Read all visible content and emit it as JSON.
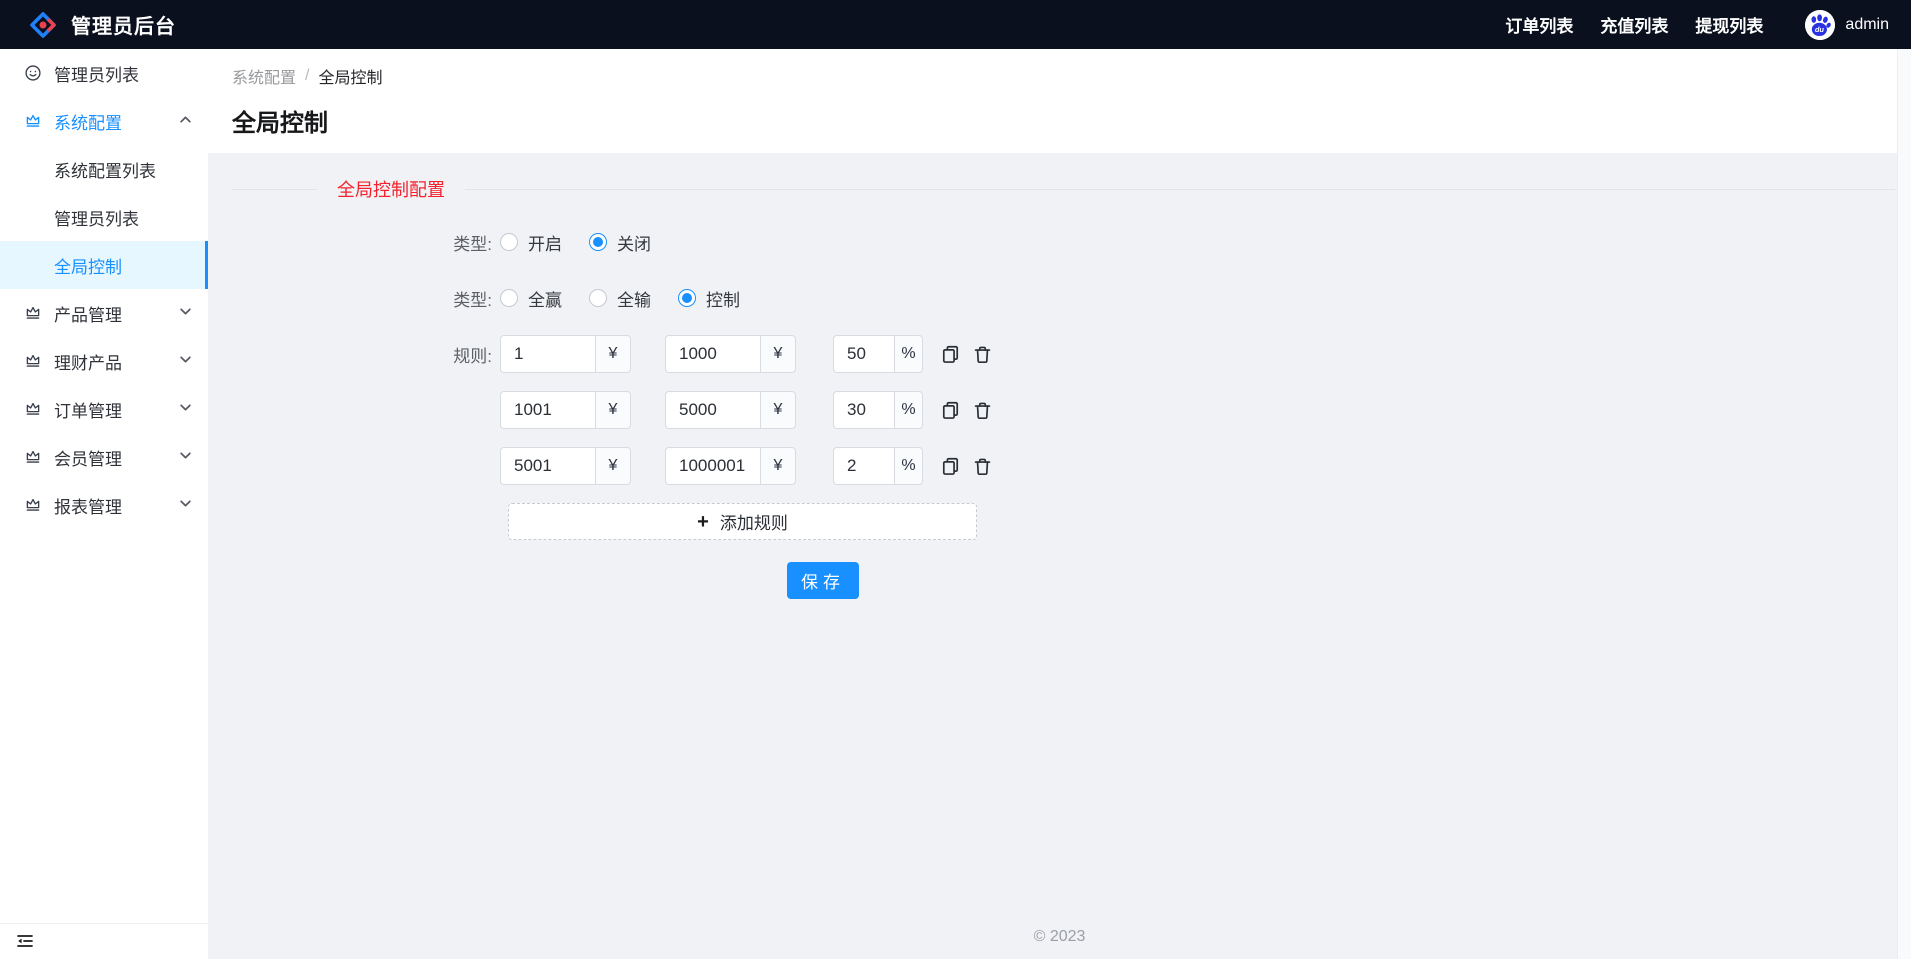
{
  "topbar": {
    "title": "管理员后台",
    "nav": [
      {
        "label": "订单列表"
      },
      {
        "label": "充值列表"
      },
      {
        "label": "提现列表"
      }
    ],
    "user": {
      "name": "admin",
      "avatar_icon": "baidu-paw-icon"
    }
  },
  "sidebar": {
    "items": [
      {
        "label": "管理员列表",
        "icon": "smile-icon"
      },
      {
        "label": "系统配置",
        "icon": "crown-icon",
        "expanded": true,
        "active": true,
        "children": [
          {
            "label": "系统配置列表",
            "active": false
          },
          {
            "label": "管理员列表",
            "active": false
          },
          {
            "label": "全局控制",
            "active": true
          }
        ]
      },
      {
        "label": "产品管理",
        "icon": "crown-icon",
        "expanded": false
      },
      {
        "label": "理财产品",
        "icon": "crown-icon",
        "expanded": false
      },
      {
        "label": "订单管理",
        "icon": "crown-icon",
        "expanded": false
      },
      {
        "label": "会员管理",
        "icon": "crown-icon",
        "expanded": false
      },
      {
        "label": "报表管理",
        "icon": "crown-icon",
        "expanded": false
      }
    ]
  },
  "breadcrumb": {
    "parent": "系统配置",
    "separator": "/",
    "current": "全局控制"
  },
  "page_title": "全局控制",
  "form": {
    "section_title": "全局控制配置",
    "switch_group": {
      "label": "类型:",
      "options": [
        {
          "label": "开启",
          "checked": false
        },
        {
          "label": "关闭",
          "checked": true
        }
      ]
    },
    "mode_group": {
      "label": "类型:",
      "options": [
        {
          "label": "全赢",
          "checked": false
        },
        {
          "label": "全输",
          "checked": false
        },
        {
          "label": "控制",
          "checked": true
        }
      ]
    },
    "rules_label": "规则:",
    "currency_unit": "¥",
    "percent_unit": "%",
    "rules": [
      {
        "min": "1",
        "max": "1000",
        "percent": "50"
      },
      {
        "min": "1001",
        "max": "5000",
        "percent": "30"
      },
      {
        "min": "5001",
        "max": "1000001",
        "percent": "2"
      }
    ],
    "add_rule_plus": "+",
    "add_rule_label": "添加规则",
    "save_label": "保存"
  },
  "footer": {
    "copyright": "© 2023"
  },
  "colors": {
    "accent": "#1890ff",
    "topbar_bg": "#0b101f",
    "section_title": "#f5222d",
    "content_bg": "#f0f2f5",
    "active_menu_bg": "#e6f7ff",
    "save_button_bg": "#1890ff",
    "logo_red": "#e8434e",
    "logo_blue": "#2080f7"
  },
  "icons": {
    "brand": "diamond-logo-icon",
    "sidebar_first": "smile-icon",
    "sidebar_group": "crown-icon",
    "rule_actions": [
      "copy-icon",
      "trash-icon"
    ],
    "collapse": "menu-fold-icon"
  }
}
